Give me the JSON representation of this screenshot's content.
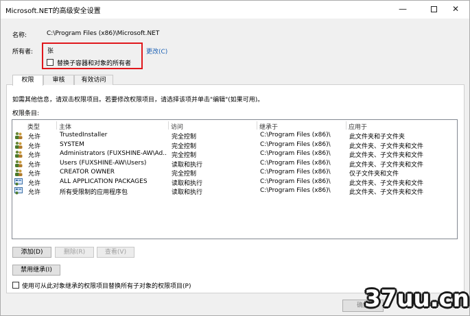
{
  "window": {
    "title": "Microsoft.NET的高级安全设置",
    "min_label": "—",
    "close_label": "✕"
  },
  "name_row": {
    "label": "名称:",
    "value": "C:\\Program Files (x86)\\Microsoft.NET"
  },
  "owner_row": {
    "label": "所有者:",
    "value": "张",
    "change_link": "更改(C)",
    "replace_owner_checkbox": "替换子容器和对象的所有者"
  },
  "tabs": [
    {
      "label": "权限"
    },
    {
      "label": "审核"
    },
    {
      "label": "有效访问"
    }
  ],
  "info_text": "如需其他信息，请双击权限项目。若要修改权限项目，请选择该项并单击\"编辑\"(如果可用)。",
  "entries_label": "权限条目:",
  "table": {
    "headers": [
      "类型",
      "主体",
      "访问",
      "继承于",
      "应用于"
    ],
    "rows": [
      {
        "icon": "users-icon",
        "type": "允许",
        "principal": "TrustedInstaller",
        "access": "完全控制",
        "inherited": "C:\\Program Files (x86)\\",
        "applies": "此文件夹和子文件夹"
      },
      {
        "icon": "users-icon",
        "type": "允许",
        "principal": "SYSTEM",
        "access": "完全控制",
        "inherited": "C:\\Program Files (x86)\\",
        "applies": "此文件夹、子文件夹和文件"
      },
      {
        "icon": "users-icon",
        "type": "允许",
        "principal": "Administrators (FUXSHINE-AW\\Ad...",
        "access": "完全控制",
        "inherited": "C:\\Program Files (x86)\\",
        "applies": "此文件夹、子文件夹和文件"
      },
      {
        "icon": "users-icon",
        "type": "允许",
        "principal": "Users (FUXSHINE-AW\\Users)",
        "access": "读取和执行",
        "inherited": "C:\\Program Files (x86)\\",
        "applies": "此文件夹、子文件夹和文件"
      },
      {
        "icon": "users-icon",
        "type": "允许",
        "principal": "CREATOR OWNER",
        "access": "完全控制",
        "inherited": "C:\\Program Files (x86)\\",
        "applies": "仅子文件夹和文件"
      },
      {
        "icon": "app-package-icon",
        "type": "允许",
        "principal": "ALL APPLICATION PACKAGES",
        "access": "读取和执行",
        "inherited": "C:\\Program Files (x86)\\",
        "applies": "此文件夹、子文件夹和文件"
      },
      {
        "icon": "app-package-icon",
        "type": "允许",
        "principal": "所有受限制的应用程序包",
        "access": "读取和执行",
        "inherited": "C:\\Program Files (x86)\\",
        "applies": "此文件夹、子文件夹和文件"
      }
    ]
  },
  "buttons": {
    "add": "添加(D)",
    "remove": "删除(R)",
    "view": "查看(V)",
    "disable_inheritance": "禁用继承(I)",
    "ok": "确定"
  },
  "replace_child_checkbox": "使用可从此对象继承的权限项目替换所有子对象的权限项目(P)",
  "watermark": "37uu.cn",
  "colors": {
    "highlight_box": "#e0161b",
    "link": "#1a5fb4"
  }
}
